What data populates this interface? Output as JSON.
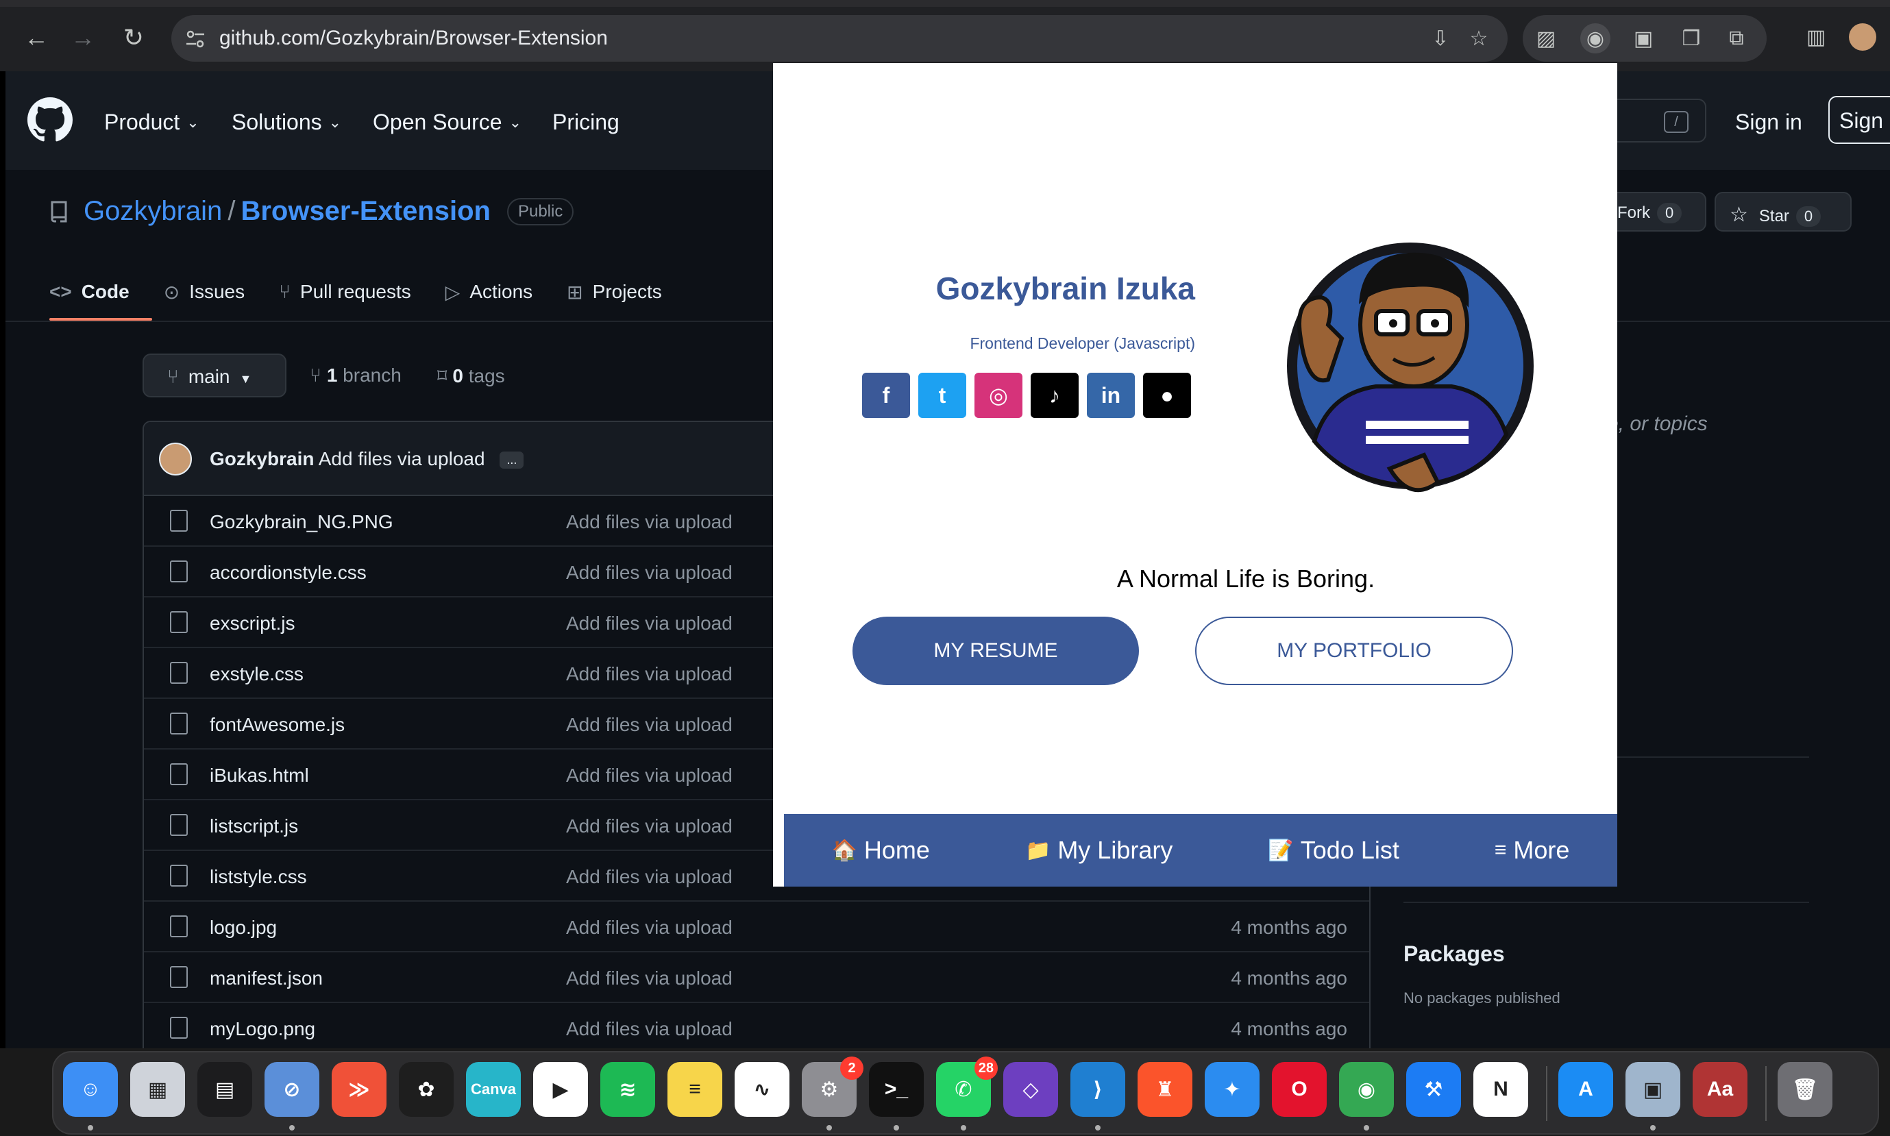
{
  "browser": {
    "url": "github.com/Gozkybrain/Browser-Extension"
  },
  "github": {
    "nav": [
      "Product",
      "Solutions",
      "Open Source",
      "Pricing"
    ],
    "search_shortcut": "/",
    "signin": "Sign in",
    "signup": "Sign u",
    "owner": "Gozkybrain",
    "separator": "/",
    "repo": "Browser-Extension",
    "visibility": "Public",
    "fork_label": "Fork",
    "fork_count": "0",
    "star_label": "Star",
    "star_count": "0",
    "tabs": [
      "Code",
      "Issues",
      "Pull requests",
      "Actions",
      "Projects"
    ],
    "branch_name": "main",
    "branch_count": "1",
    "branch_word": "branch",
    "tag_count": "0",
    "tag_word": "tags",
    "commit_author": "Gozkybrain",
    "commit_message": "Add files via upload",
    "commit_more": "...",
    "files": [
      {
        "name": "Gozkybrain_NG.PNG",
        "message": "Add files via upload",
        "age": ""
      },
      {
        "name": "accordionstyle.css",
        "message": "Add files via upload",
        "age": ""
      },
      {
        "name": "exscript.js",
        "message": "Add files via upload",
        "age": ""
      },
      {
        "name": "exstyle.css",
        "message": "Add files via upload",
        "age": ""
      },
      {
        "name": "fontAwesome.js",
        "message": "Add files via upload",
        "age": ""
      },
      {
        "name": "iBukas.html",
        "message": "Add files via upload",
        "age": ""
      },
      {
        "name": "listscript.js",
        "message": "Add files via upload",
        "age": ""
      },
      {
        "name": "liststyle.css",
        "message": "Add files via upload",
        "age": ""
      },
      {
        "name": "logo.jpg",
        "message": "Add files via upload",
        "age": "4 months ago"
      },
      {
        "name": "manifest.json",
        "message": "Add files via upload",
        "age": "4 months ago"
      },
      {
        "name": "myLogo.png",
        "message": "Add files via upload",
        "age": "4 months ago"
      }
    ],
    "about_placeholder": "ite, or topics",
    "packages_title": "Packages",
    "packages_none": "No packages published"
  },
  "popup": {
    "name": "Gozkybrain Izuka",
    "role": "Frontend Developer (Javascript)",
    "social": [
      {
        "icon": "facebook-icon",
        "glyph": "f",
        "color": "#3b5998"
      },
      {
        "icon": "twitter-icon",
        "glyph": "t",
        "color": "#1da1f2"
      },
      {
        "icon": "instagram-icon",
        "glyph": "◎",
        "color": "#d6337a"
      },
      {
        "icon": "tiktok-icon",
        "glyph": "♪",
        "color": "#000000"
      },
      {
        "icon": "linkedin-icon",
        "glyph": "in",
        "color": "#3567a8"
      },
      {
        "icon": "github-icon",
        "glyph": "●",
        "color": "#000000"
      }
    ],
    "quote": "A Normal Life is Boring.",
    "resume_button": "MY RESUME",
    "portfolio_button": "MY PORTFOLIO",
    "nav": [
      {
        "icon": "🏠",
        "label": "Home"
      },
      {
        "icon": "📁",
        "label": "My Library"
      },
      {
        "icon": "📝",
        "label": "Todo List"
      },
      {
        "icon": "≡",
        "label": "More"
      }
    ],
    "brand_color": "#3b5998"
  },
  "dock": {
    "apps": [
      {
        "name": "Finder",
        "glyph": "☺",
        "bg": "#3d8ff5",
        "dot": true
      },
      {
        "name": "Launchpad",
        "glyph": "▦",
        "bg": "#cfd3da",
        "dot": false
      },
      {
        "name": "Mission Control",
        "glyph": "▤",
        "bg": "#1c1c1e",
        "dot": false
      },
      {
        "name": "Safari Nightly",
        "glyph": "⊘",
        "bg": "#5b8fd9",
        "dot": true
      },
      {
        "name": "Swift",
        "glyph": "≫",
        "bg": "#f05138",
        "dot": false
      },
      {
        "name": "Figma",
        "glyph": "✿",
        "bg": "#1e1e1e",
        "dot": false
      },
      {
        "name": "Canva",
        "glyph": "Canva",
        "bg": "#27b5c9",
        "dot": false
      },
      {
        "name": "Infuse",
        "glyph": "▶",
        "bg": "#ffffff",
        "dot": false
      },
      {
        "name": "Spotify",
        "glyph": "≋",
        "bg": "#1db954",
        "dot": false
      },
      {
        "name": "Notes",
        "glyph": "≡",
        "bg": "#f7d54a",
        "dot": false
      },
      {
        "name": "Freeform",
        "glyph": "∿",
        "bg": "#ffffff",
        "dot": false
      },
      {
        "name": "System Settings",
        "glyph": "⚙",
        "bg": "#8e8e93",
        "dot": true,
        "badge": "2"
      },
      {
        "name": "Terminal",
        "glyph": ">_",
        "bg": "#111111",
        "dot": true
      },
      {
        "name": "WhatsApp",
        "glyph": "✆",
        "bg": "#25d366",
        "dot": true,
        "badge": "28"
      },
      {
        "name": "Visual Studio",
        "glyph": "◇",
        "bg": "#6d3fc0",
        "dot": false
      },
      {
        "name": "VS Code",
        "glyph": "⟩",
        "bg": "#1f7fd1",
        "dot": true
      },
      {
        "name": "Brave",
        "glyph": "♜",
        "bg": "#fb542b",
        "dot": false
      },
      {
        "name": "Safari",
        "glyph": "✦",
        "bg": "#2b8cf0",
        "dot": false
      },
      {
        "name": "Opera",
        "glyph": "O",
        "bg": "#e3132d",
        "dot": false
      },
      {
        "name": "Chrome",
        "glyph": "◉",
        "bg": "#34a853",
        "dot": true
      },
      {
        "name": "Xcode",
        "glyph": "⚒",
        "bg": "#1c7cf4",
        "dot": false
      },
      {
        "name": "Notion",
        "glyph": "N",
        "bg": "#ffffff",
        "dot": false
      },
      {
        "name": "App Store",
        "glyph": "A",
        "bg": "#1b8cf4",
        "dot": false
      },
      {
        "name": "Preview",
        "glyph": "▣",
        "bg": "#9fb5cc",
        "dot": true
      },
      {
        "name": "Dictionary",
        "glyph": "Aa",
        "bg": "#b03434",
        "dot": false
      },
      {
        "name": "Trash",
        "glyph": "🗑",
        "bg": "#6e6e73",
        "dot": false
      }
    ]
  }
}
